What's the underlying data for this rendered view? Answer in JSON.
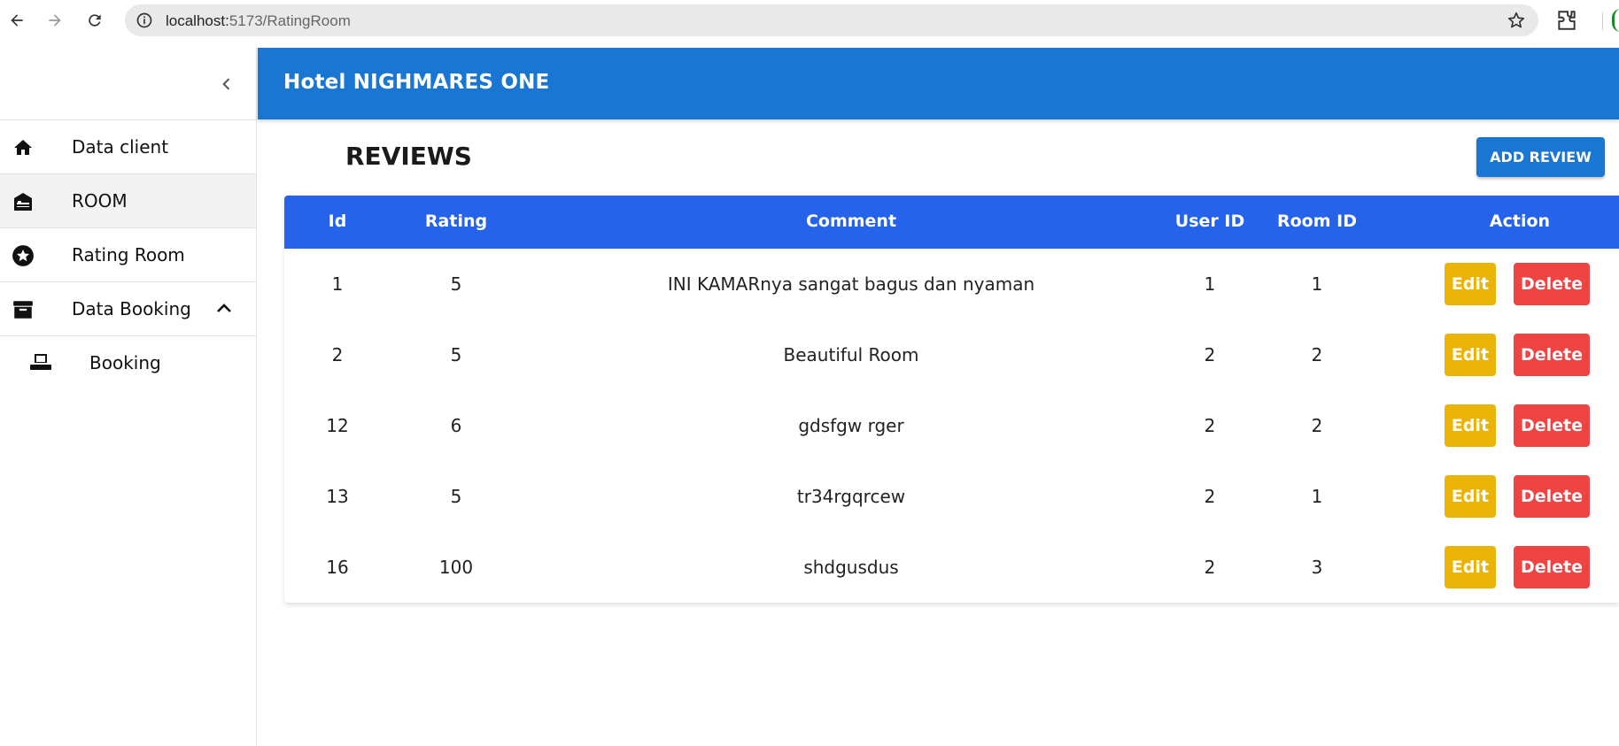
{
  "browser": {
    "url_host": "localhost:",
    "url_port_path": "5173/RatingRoom"
  },
  "app": {
    "title": "Hotel NIGHMARES ONE"
  },
  "sidebar": {
    "items": [
      {
        "label": "Data client",
        "icon": "home-icon"
      },
      {
        "label": "ROOM",
        "icon": "hotel-icon"
      },
      {
        "label": "Rating Room",
        "icon": "star-circle-icon"
      },
      {
        "label": "Data Booking",
        "icon": "archive-icon"
      }
    ],
    "sub_items": [
      {
        "label": "Booking",
        "icon": "printer-icon"
      }
    ]
  },
  "page": {
    "title": "REVIEWS",
    "add_button": "ADD REVIEW"
  },
  "table": {
    "headers": [
      "Id",
      "Rating",
      "Comment",
      "User ID",
      "Room ID",
      "Action"
    ],
    "edit_label": "Edit",
    "delete_label": "Delete",
    "rows": [
      {
        "id": "1",
        "rating": "5",
        "comment": "INI KAMARnya sangat bagus dan nyaman",
        "user_id": "1",
        "room_id": "1"
      },
      {
        "id": "2",
        "rating": "5",
        "comment": "Beautiful Room",
        "user_id": "2",
        "room_id": "2"
      },
      {
        "id": "12",
        "rating": "6",
        "comment": "gdsfgw rger",
        "user_id": "2",
        "room_id": "2"
      },
      {
        "id": "13",
        "rating": "5",
        "comment": "tr34rgqrcew",
        "user_id": "2",
        "room_id": "1"
      },
      {
        "id": "16",
        "rating": "100",
        "comment": "shdgusdus",
        "user_id": "2",
        "room_id": "3"
      }
    ]
  },
  "colors": {
    "header_bg": "#1976d2",
    "table_header_bg": "#2563eb",
    "edit_bg": "#eab308",
    "delete_bg": "#ef4444"
  }
}
